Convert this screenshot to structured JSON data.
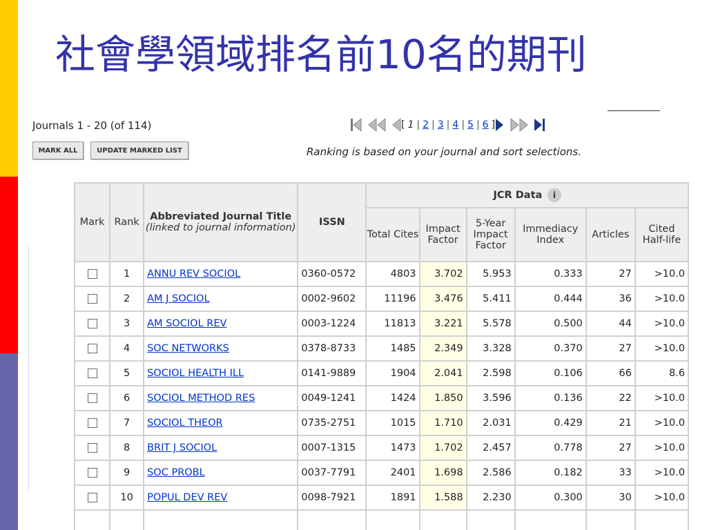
{
  "title": "社會學領域排名前10名的期刊",
  "journals_count": "Journals 1 - 20 (of 114)",
  "pager": {
    "open_bracket": "[",
    "close_bracket": "]",
    "current_page": "1",
    "pages": [
      "2",
      "3",
      "4",
      "5",
      "6"
    ],
    "separator": "|"
  },
  "buttons": {
    "mark_all": "MARK ALL",
    "update_marked_list": "UPDATE MARKED LIST"
  },
  "ranking_note": "Ranking is based on your journal and sort selections.",
  "table": {
    "headers": {
      "mark": "Mark",
      "rank": "Rank",
      "title_main": "Abbreviated Journal Title",
      "title_sub": "(linked to journal information)",
      "issn": "ISSN",
      "jcr_data": "JCR Data",
      "total_cites": "Total Cites",
      "impact_factor": "Impact Factor",
      "five_year": "5-Year Impact Factor",
      "immediacy": "Immediacy Index",
      "articles": "Articles",
      "half_life": "Cited Half-life"
    },
    "rows": [
      {
        "rank": "1",
        "title": "ANNU REV SOCIOL",
        "issn": "0360-0572",
        "cites": "4803",
        "if": "3.702",
        "five": "5.953",
        "imm": "0.333",
        "art": "27",
        "half": ">10.0"
      },
      {
        "rank": "2",
        "title": "AM J SOCIOL",
        "issn": "0002-9602",
        "cites": "11196",
        "if": "3.476",
        "five": "5.411",
        "imm": "0.444",
        "art": "36",
        "half": ">10.0"
      },
      {
        "rank": "3",
        "title": "AM SOCIOL REV",
        "issn": "0003-1224",
        "cites": "11813",
        "if": "3.221",
        "five": "5.578",
        "imm": "0.500",
        "art": "44",
        "half": ">10.0"
      },
      {
        "rank": "4",
        "title": "SOC NETWORKS",
        "issn": "0378-8733",
        "cites": "1485",
        "if": "2.349",
        "five": "3.328",
        "imm": "0.370",
        "art": "27",
        "half": ">10.0"
      },
      {
        "rank": "5",
        "title": "SOCIOL HEALTH ILL",
        "issn": "0141-9889",
        "cites": "1904",
        "if": "2.041",
        "five": "2.598",
        "imm": "0.106",
        "art": "66",
        "half": "8.6"
      },
      {
        "rank": "6",
        "title": "SOCIOL METHOD RES",
        "issn": "0049-1241",
        "cites": "1424",
        "if": "1.850",
        "five": "3.596",
        "imm": "0.136",
        "art": "22",
        "half": ">10.0"
      },
      {
        "rank": "7",
        "title": "SOCIOL THEOR",
        "issn": "0735-2751",
        "cites": "1015",
        "if": "1.710",
        "five": "2.031",
        "imm": "0.429",
        "art": "21",
        "half": ">10.0"
      },
      {
        "rank": "8",
        "title": "BRIT J SOCIOL",
        "issn": "0007-1315",
        "cites": "1473",
        "if": "1.702",
        "five": "2.457",
        "imm": "0.778",
        "art": "27",
        "half": ">10.0"
      },
      {
        "rank": "9",
        "title": "SOC PROBL",
        "issn": "0037-7791",
        "cites": "2401",
        "if": "1.698",
        "five": "2.586",
        "imm": "0.182",
        "art": "33",
        "half": ">10.0"
      },
      {
        "rank": "10",
        "title": "POPUL DEV REV",
        "issn": "0098-7921",
        "cites": "1891",
        "if": "1.588",
        "five": "2.230",
        "imm": "0.300",
        "art": "30",
        "half": ">10.0"
      }
    ]
  },
  "colors": {
    "title": "#3333aa",
    "bar_yellow": "#ffcc00",
    "bar_red": "#ff0000",
    "bar_blue": "#6666aa",
    "link": "#0033cc",
    "impact_factor_highlight": "#ffffe6"
  },
  "icons": [
    "first-page-icon",
    "previous-group-icon",
    "previous-page-icon",
    "next-page-icon",
    "next-group-icon",
    "last-page-icon",
    "info-icon",
    "checkbox-icon"
  ]
}
